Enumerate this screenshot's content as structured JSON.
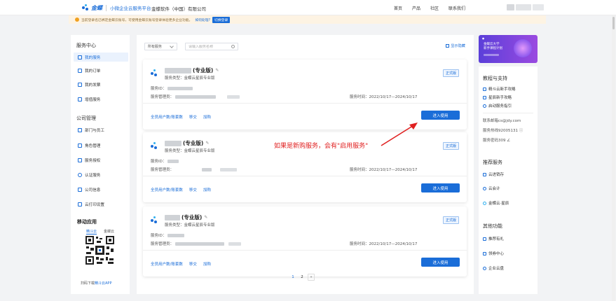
{
  "header": {
    "brand": "金蝶",
    "subtitle": "小微企业云服务平台",
    "company": "金蝶软件（中国）有限公司",
    "nav": [
      "首页",
      "产品",
      "社区",
      "联系我们"
    ]
  },
  "notice": {
    "text": "当前登录名已绑定金蝶云账号，可使用金蝶云账号登录体验更多企业功能。",
    "link": "如何处理?",
    "button": "切换登录"
  },
  "sidebar": {
    "section1": "服务中心",
    "items1": [
      "我的服务",
      "我的订单",
      "我的发票",
      "增值服务"
    ],
    "section2": "公司管理",
    "items2": [
      "部门与员工",
      "角色管理",
      "服务授权",
      "认证服务",
      "公司信息",
      "云打印设置"
    ],
    "mobile_title": "移动应用",
    "mobile_tabs": [
      "精斗云",
      "金蝶云"
    ],
    "download_prefix": "扫码下载",
    "download_app": "精斗云APP"
  },
  "filter": {
    "select_value": "所有服务",
    "search_placeholder": "请输入服务名称",
    "show_hidden": "显示隐藏"
  },
  "cards": [
    {
      "edition": "(专业版)",
      "type": "服务类型：金蝶云星辰专业版",
      "status": "正式版",
      "id_label": "服务ID：",
      "manager_label": "服务管理员：",
      "time": "服务时间：2022/10/17—2024/10/17",
      "links": [
        "全员用户数/账套数",
        "移交",
        "加购"
      ],
      "button": "进入使用"
    },
    {
      "edition": "(专业版)",
      "type": "服务类型：金蝶云星辰专业版",
      "status": "正式版",
      "id_label": "服务ID：",
      "manager_label": "服务管理员：",
      "time": "服务时间：2022/10/17—2024/10/17",
      "links": [
        "全员用户数/账套数",
        "移交",
        "加购"
      ],
      "button": "进入使用"
    },
    {
      "edition": "(专业版)",
      "type": "服务类型：金蝶云星辰专业版",
      "status": "正式版",
      "id_label": "服务ID：",
      "manager_label": "服务管理员：",
      "time": "服务时间：2022/10/17—2024/10/17",
      "links": [
        "全员用户数/账套数",
        "移交",
        "加购"
      ],
      "button": "进入使用"
    }
  ],
  "annotation": "如果是新购服务，会有\"启用服务\"",
  "pagination": {
    "pages": [
      "1",
      "2"
    ],
    "next": "»"
  },
  "right": {
    "banner_title": "金蝶云大学\n新手课程计划",
    "tutorial_title": "教程与支持",
    "tutorials": [
      "精斗云新手攻略",
      "星辰新手攻略",
      "启动服务指引"
    ],
    "contact_email": "联系邮箱cs@jdy.com",
    "contact_phone": "服务热线92005131 ⓘ",
    "service_code": "服务密码309 ∠",
    "recommend_title": "推荐服务",
    "recommend": [
      "云进销存",
      "云会计",
      "金蝶云·星辰"
    ],
    "other_title": "其他功能",
    "other": [
      "推荐有礼",
      "领券中心",
      "企业云盘"
    ]
  },
  "colors": {
    "accent": "#1a6dd8",
    "annotation": "#e02020",
    "notice_bg": "#fdf3e3"
  }
}
